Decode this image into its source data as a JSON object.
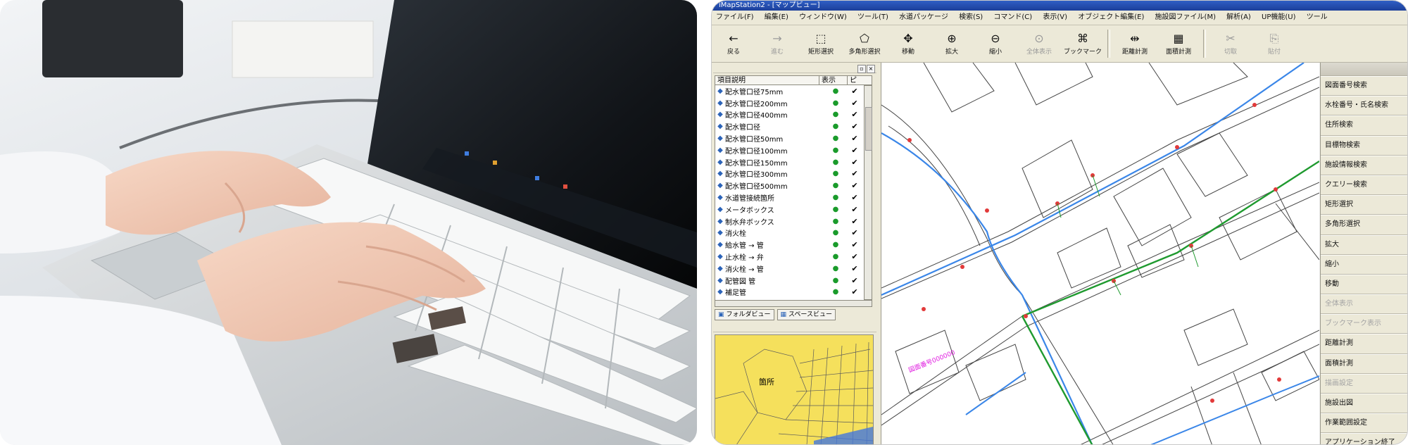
{
  "window": {
    "title": "iMapStation2 - [マップビュー]"
  },
  "menu": [
    "ファイル(F)",
    "編集(E)",
    "ウィンドウ(W)",
    "ツール(T)",
    "水道パッケージ",
    "検索(S)",
    "コマンド(C)",
    "表示(V)",
    "オブジェクト編集(E)",
    "施設図ファイル(M)",
    "解析(A)",
    "UP機能(U)",
    "ツール"
  ],
  "toolbar": [
    {
      "label": "戻る",
      "icon": "←",
      "enabled": true
    },
    {
      "label": "進む",
      "icon": "→",
      "enabled": false
    },
    {
      "label": "矩形選択",
      "icon": "⬚",
      "enabled": true
    },
    {
      "label": "多角形選択",
      "icon": "⬠",
      "enabled": true
    },
    {
      "label": "移動",
      "icon": "✥",
      "enabled": true
    },
    {
      "label": "拡大",
      "icon": "⊕",
      "enabled": true
    },
    {
      "label": "縮小",
      "icon": "⊖",
      "enabled": true
    },
    {
      "label": "全体表示",
      "icon": "⊙",
      "enabled": false
    },
    {
      "label": "ブックマーク",
      "icon": "⌘",
      "enabled": true
    },
    {
      "label": "距離計測",
      "icon": "⇹",
      "enabled": true
    },
    {
      "label": "面積計測",
      "icon": "▦",
      "enabled": true
    },
    {
      "label": "切取",
      "icon": "✂",
      "enabled": false
    },
    {
      "label": "貼付",
      "icon": "⎘",
      "enabled": false
    }
  ],
  "layers": {
    "headers": [
      "項目説明",
      "表示",
      "ピ"
    ],
    "items": [
      "配水管口径75mm",
      "配水管口径200mm",
      "配水管口径400mm",
      "配水管口径",
      "配水管口径50mm",
      "配水管口径100mm",
      "配水管口径150mm",
      "配水管口径300mm",
      "配水管口径500mm",
      "水道管接続箇所",
      "メータボックス",
      "制水弁ボックス",
      "消火栓",
      "給水管 → 管",
      "止水栓 → 弁",
      "消火栓 → 管",
      "配管図 管",
      "補足管"
    ],
    "visible_mark": "●",
    "check_mark": "✔"
  },
  "pane_tabs": [
    "フォルダビュー",
    "スペースビュー"
  ],
  "overview": {
    "label": "箇所"
  },
  "map": {
    "annotation": "図面番号000000"
  },
  "right_menu": [
    {
      "label": "図面番号検索",
      "enabled": true
    },
    {
      "label": "水栓番号・氏名検索",
      "enabled": true
    },
    {
      "label": "住所検索",
      "enabled": true
    },
    {
      "label": "目標物検索",
      "enabled": true
    },
    {
      "label": "施設情報検索",
      "enabled": true
    },
    {
      "label": "クエリー検索",
      "enabled": true
    },
    {
      "label": "矩形選択",
      "enabled": true
    },
    {
      "label": "多角形選択",
      "enabled": true
    },
    {
      "label": "拡大",
      "enabled": true
    },
    {
      "label": "縮小",
      "enabled": true
    },
    {
      "label": "移動",
      "enabled": true
    },
    {
      "label": "全体表示",
      "enabled": false
    },
    {
      "label": "ブックマーク表示",
      "enabled": false
    },
    {
      "label": "距離計測",
      "enabled": true
    },
    {
      "label": "面積計測",
      "enabled": true
    },
    {
      "label": "描画設定",
      "enabled": false
    },
    {
      "label": "施設出図",
      "enabled": true
    },
    {
      "label": "作業範囲設定",
      "enabled": true
    },
    {
      "label": "アプリケーション終了",
      "enabled": true
    }
  ],
  "colors": {
    "pipe_blue": "#3a86e8",
    "pipe_green": "#1f9a2f",
    "overview_yellow": "#f5e05c",
    "title_blue": "#2f5fc4"
  }
}
